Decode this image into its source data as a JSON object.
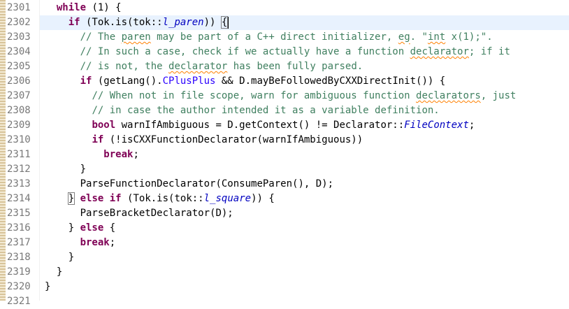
{
  "editor": {
    "line_numbers": [
      "2301",
      "2302",
      "2303",
      "2304",
      "2305",
      "2306",
      "2307",
      "2308",
      "2309",
      "2310",
      "2311",
      "2312",
      "2313",
      "2314",
      "2315",
      "2316",
      "2317",
      "2318",
      "2319",
      "2320",
      "2321"
    ],
    "lines": [
      {
        "n": "2301",
        "indent": "  ",
        "tokens": [
          {
            "t": "while",
            "c": "kw"
          },
          {
            "t": " (1) {",
            "c": ""
          }
        ]
      },
      {
        "n": "2302",
        "indent": "    ",
        "current": true,
        "tokens": [
          {
            "t": "if",
            "c": "kw"
          },
          {
            "t": " (Tok.is(tok::",
            "c": ""
          },
          {
            "t": "l_paren",
            "c": "en"
          },
          {
            "t": ")) ",
            "c": ""
          },
          {
            "t": "{",
            "c": "bm"
          },
          {
            "t": "",
            "c": "caret"
          }
        ]
      },
      {
        "n": "2303",
        "indent": "      ",
        "tokens": [
          {
            "t": "// The ",
            "c": "cm"
          },
          {
            "t": "paren",
            "c": "cm sp"
          },
          {
            "t": " may be part of a C++ direct initializer, ",
            "c": "cm"
          },
          {
            "t": "eg",
            "c": "cm sp"
          },
          {
            "t": ". \"",
            "c": "cm"
          },
          {
            "t": "int",
            "c": "cm sp"
          },
          {
            "t": " x(1);\".",
            "c": "cm"
          }
        ]
      },
      {
        "n": "2304",
        "indent": "      ",
        "tokens": [
          {
            "t": "// In such a case, check if we actually have a function ",
            "c": "cm"
          },
          {
            "t": "declarator",
            "c": "cm sp"
          },
          {
            "t": "; if it",
            "c": "cm"
          }
        ]
      },
      {
        "n": "2305",
        "indent": "      ",
        "tokens": [
          {
            "t": "// is not, the ",
            "c": "cm"
          },
          {
            "t": "declarator",
            "c": "cm sp"
          },
          {
            "t": " has been fully parsed.",
            "c": "cm"
          }
        ]
      },
      {
        "n": "2306",
        "indent": "      ",
        "tokens": [
          {
            "t": "if",
            "c": "kw"
          },
          {
            "t": " (getLang().",
            "c": ""
          },
          {
            "t": "CPlusPlus",
            "c": "st"
          },
          {
            "t": " && D.mayBeFollowedByCXXDirectInit()) {",
            "c": ""
          }
        ]
      },
      {
        "n": "2307",
        "indent": "        ",
        "tokens": [
          {
            "t": "// When not in file scope, warn for ambiguous function ",
            "c": "cm"
          },
          {
            "t": "declarators",
            "c": "cm sp"
          },
          {
            "t": ", just",
            "c": "cm"
          }
        ]
      },
      {
        "n": "2308",
        "indent": "        ",
        "tokens": [
          {
            "t": "// in case the author intended it as a variable definition.",
            "c": "cm"
          }
        ]
      },
      {
        "n": "2309",
        "indent": "        ",
        "tokens": [
          {
            "t": "bool",
            "c": "kw"
          },
          {
            "t": " warnIfAmbiguous = D.getContext() != Declarator::",
            "c": ""
          },
          {
            "t": "FileContext",
            "c": "en"
          },
          {
            "t": ";",
            "c": ""
          }
        ]
      },
      {
        "n": "2310",
        "indent": "        ",
        "tokens": [
          {
            "t": "if",
            "c": "kw"
          },
          {
            "t": " (!isCXXFunctionDeclarator(warnIfAmbiguous))",
            "c": ""
          }
        ]
      },
      {
        "n": "2311",
        "indent": "          ",
        "tokens": [
          {
            "t": "break",
            "c": "kw"
          },
          {
            "t": ";",
            "c": ""
          }
        ]
      },
      {
        "n": "2312",
        "indent": "      ",
        "tokens": [
          {
            "t": "}",
            "c": ""
          }
        ]
      },
      {
        "n": "2313",
        "indent": "      ",
        "tokens": [
          {
            "t": "ParseFunctionDeclarator(ConsumeParen(), D);",
            "c": ""
          }
        ]
      },
      {
        "n": "2314",
        "indent": "    ",
        "tokens": [
          {
            "t": "}",
            "c": "bm"
          },
          {
            "t": " ",
            "c": ""
          },
          {
            "t": "else",
            "c": "kw"
          },
          {
            "t": " ",
            "c": ""
          },
          {
            "t": "if",
            "c": "kw"
          },
          {
            "t": " (Tok.is(tok::",
            "c": ""
          },
          {
            "t": "l_square",
            "c": "en"
          },
          {
            "t": ")) {",
            "c": ""
          }
        ]
      },
      {
        "n": "2315",
        "indent": "      ",
        "tokens": [
          {
            "t": "ParseBracketDeclarator(D);",
            "c": ""
          }
        ]
      },
      {
        "n": "2316",
        "indent": "    ",
        "tokens": [
          {
            "t": "} ",
            "c": ""
          },
          {
            "t": "else",
            "c": "kw"
          },
          {
            "t": " {",
            "c": ""
          }
        ]
      },
      {
        "n": "2317",
        "indent": "      ",
        "tokens": [
          {
            "t": "break",
            "c": "kw"
          },
          {
            "t": ";",
            "c": ""
          }
        ]
      },
      {
        "n": "2318",
        "indent": "    ",
        "tokens": [
          {
            "t": "}",
            "c": ""
          }
        ]
      },
      {
        "n": "2319",
        "indent": "  ",
        "tokens": [
          {
            "t": "}",
            "c": ""
          }
        ]
      },
      {
        "n": "2320",
        "indent": "",
        "tokens": [
          {
            "t": "}",
            "c": ""
          }
        ]
      },
      {
        "n": "2321",
        "indent": "",
        "tokens": []
      }
    ]
  },
  "colors": {
    "keyword": "#7f0055",
    "comment": "#3f7f5f",
    "field": "#0000c0",
    "constant": "#2a00ff",
    "current_line": "#e8f2fe",
    "spell_underline": "#ff8000"
  }
}
